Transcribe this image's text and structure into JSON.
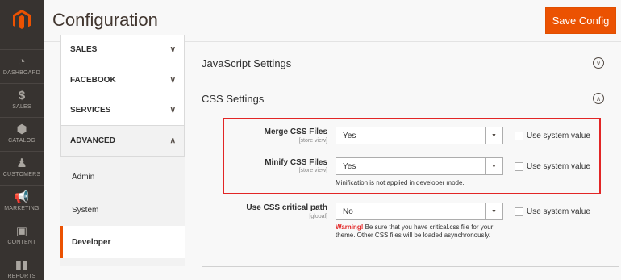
{
  "nav": {
    "items": [
      {
        "label": "DASHBOARD",
        "icon": "dashboard-icon"
      },
      {
        "label": "SALES",
        "icon": "dollar-icon"
      },
      {
        "label": "CATALOG",
        "icon": "cube-icon"
      },
      {
        "label": "CUSTOMERS",
        "icon": "person-icon"
      },
      {
        "label": "MARKETING",
        "icon": "megaphone-icon"
      },
      {
        "label": "CONTENT",
        "icon": "layout-icon"
      },
      {
        "label": "REPORTS",
        "icon": "bar-chart-icon"
      }
    ]
  },
  "header": {
    "title": "Configuration",
    "save_label": "Save Config"
  },
  "sidebar": {
    "sections": [
      {
        "label": "SALES"
      },
      {
        "label": "FACEBOOK"
      },
      {
        "label": "SERVICES"
      },
      {
        "label": "ADVANCED"
      }
    ],
    "sub_items": [
      {
        "label": "Admin"
      },
      {
        "label": "System"
      },
      {
        "label": "Developer"
      }
    ]
  },
  "main": {
    "js_group": "JavaScript Settings",
    "css_group": "CSS Settings",
    "fields": [
      {
        "label": "Merge CSS Files",
        "scope": "[store view]",
        "value": "Yes",
        "use_system": "Use system value"
      },
      {
        "label": "Minify CSS Files",
        "scope": "[store view]",
        "value": "Yes",
        "use_system": "Use system value",
        "note": "Minification is not applied in developer mode."
      },
      {
        "label": "Use CSS critical path",
        "scope": "[global]",
        "value": "No",
        "use_system": "Use system value",
        "warning_label": "Warning!",
        "warning_text": " Be sure that you have critical.css file for your theme. Other CSS files will be loaded asynchronously."
      }
    ]
  },
  "colors": {
    "accent": "#eb5202",
    "nav_bg": "#373330",
    "highlight": "#e22626"
  }
}
